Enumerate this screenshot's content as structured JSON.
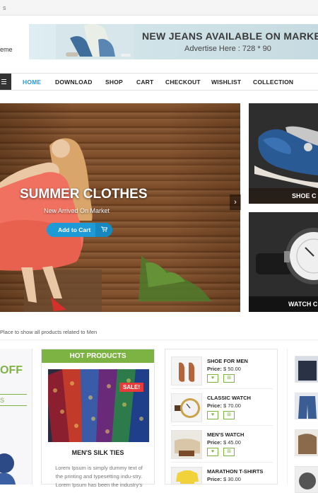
{
  "top_bar": {
    "text": "s"
  },
  "logo": {
    "text": "eme"
  },
  "banner": {
    "title": "NEW JEANS AVAILABLE ON MARKET",
    "subtitle": "Advertise Here : 728 * 90"
  },
  "nav": {
    "items": [
      "HOME",
      "DOWNLOAD",
      "SHOP",
      "CART",
      "CHECKOUT",
      "WISHLIST",
      "COLLECTION"
    ],
    "active": "HOME"
  },
  "hero": {
    "title": "SUMMER CLOTHES",
    "subtitle": "New Arrived On Market",
    "button_label": "Add to Cart",
    "next_icon": "chevron-right-icon"
  },
  "side_banners": [
    {
      "label": "SHOE C"
    },
    {
      "label": "WATCH C"
    }
  ],
  "hint": "Place to show all products related to Men",
  "offer_card": {
    "text": "OFF",
    "subtext": "S"
  },
  "hot_products": {
    "header": "HOT PRODUCTS",
    "badge": "SALE!",
    "product_name": "MEN'S SILK TIES",
    "description": "Lorem Ipsum is simply dummy text of the printing and typesetting indu-stry. Lorem Ipsum has been the industry's"
  },
  "product_list": [
    {
      "name": "SHOE FOR MEN",
      "price_label": "Price:",
      "price": "$ 50.00"
    },
    {
      "name": "CLASSIC WATCH",
      "price_label": "Price:",
      "price": "$ 70.00"
    },
    {
      "name": "MEN'S WATCH",
      "price_label": "Price:",
      "price": "$ 45.00"
    },
    {
      "name": "MARATHON T-SHIRTS",
      "price_label": "Price:",
      "price": "$ 30.00"
    }
  ],
  "colors": {
    "accent_blue": "#1e9ad6",
    "accent_green": "#7cb342",
    "sale_red": "#e83a3a"
  }
}
